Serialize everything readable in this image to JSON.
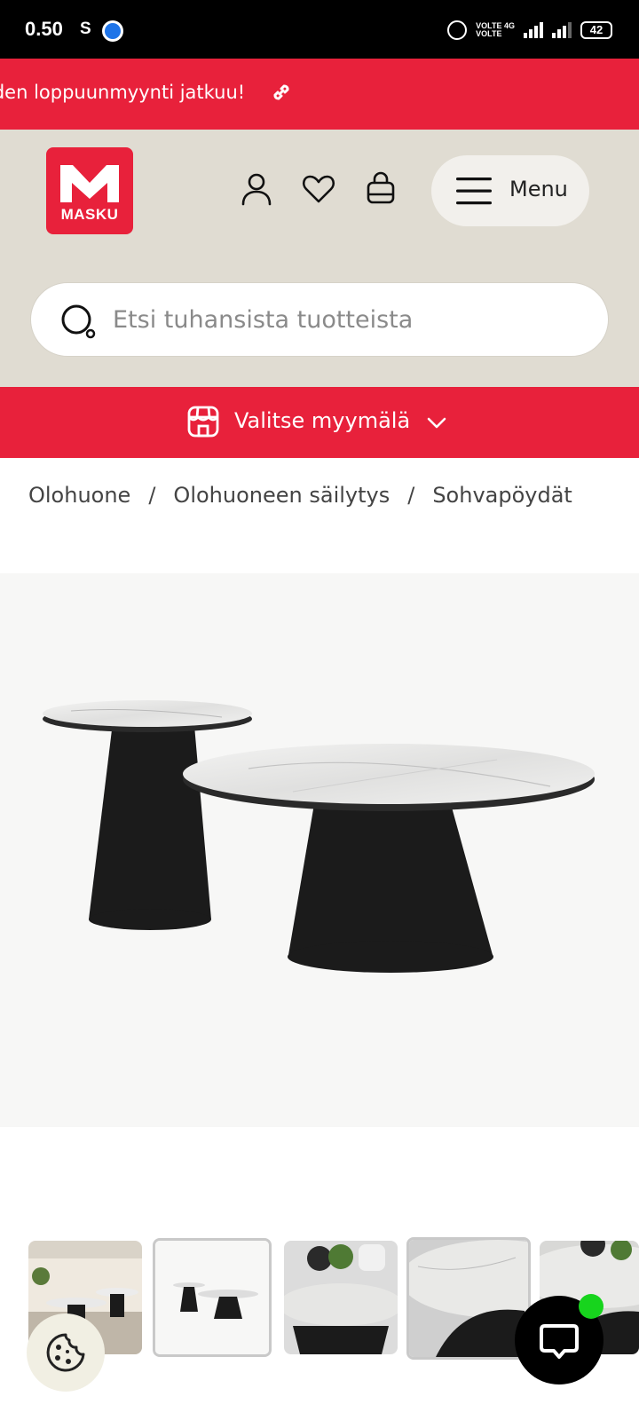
{
  "status_bar": {
    "time": "0.50",
    "carrier_letter": "S",
    "volte_1": "VOLTE",
    "volte_2": "VOLTE",
    "network": "4G",
    "battery": "42"
  },
  "promo": {
    "text": "iden loppuunmyynti jatkuu!",
    "icon": "link-icon"
  },
  "header": {
    "logo_text": "MASKU",
    "icons": [
      "user-icon",
      "heart-icon",
      "bag-icon"
    ],
    "menu_label": "Menu"
  },
  "search": {
    "placeholder": "Etsi tuhansista tuotteista",
    "value": ""
  },
  "store_selector": {
    "label": "Valitse myymälä"
  },
  "breadcrumb": {
    "items": [
      "Olohuone",
      "Olohuoneen säilytys",
      "Sohvapöydät"
    ],
    "separator": "/"
  },
  "gallery": {
    "thumbnail_count_visible": 5,
    "selected_index": 1
  },
  "colors": {
    "brand_red": "#e8213b",
    "header_beige": "#e0dcd2",
    "chat_online": "#17d41d"
  }
}
